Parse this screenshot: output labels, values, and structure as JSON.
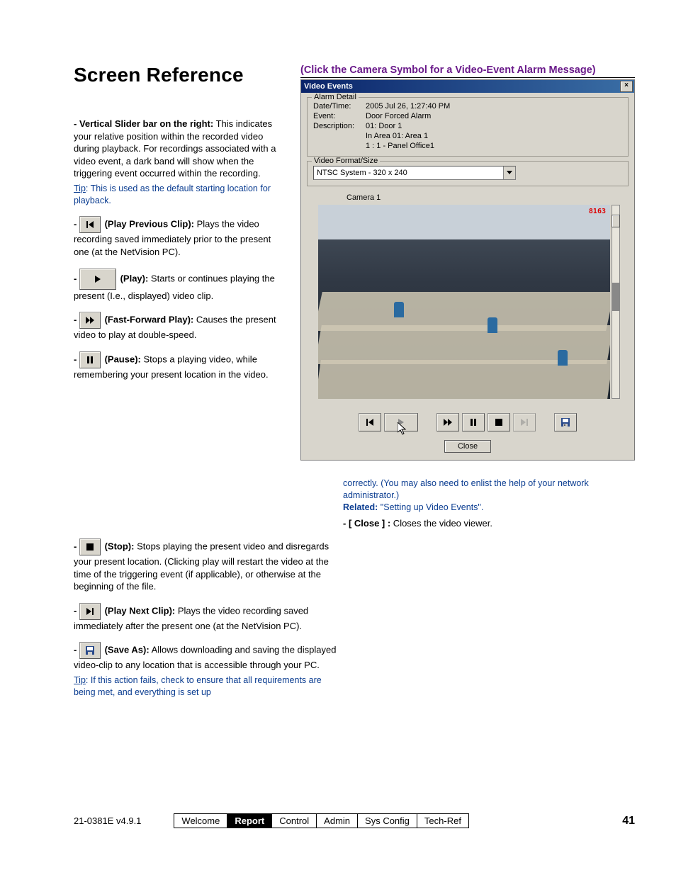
{
  "heading": "Screen Reference",
  "sub_heading": "(Click the Camera Symbol for a Video-Event Alarm Message)",
  "left": {
    "slider_label": "Vertical Slider bar on the right:",
    "slider_text": "  This indicates your relative position within the recorded video during playback.  For recordings associated with a video event, a dark band will show when the triggering event occurred within the recording.",
    "slider_tip_label": "Tip",
    "slider_tip": ":  This is used as the default starting location for playback.",
    "prev_label": " (Play Previous Clip):",
    "prev_text": "  Plays the video recording saved immediately prior to the present one (at the NetVision PC).",
    "play_label": " (Play):",
    "play_text": "  Starts or continues playing the present (I.e., displayed) video clip.",
    "ff_label": " (Fast-Forward Play):",
    "ff_text": "  Causes the present video to play at double-speed.",
    "pause_label": " (Pause):",
    "pause_text": "  Stops a playing video, while remembering your present location in the video.",
    "stop_label": " (Stop):",
    "stop_text": "  Stops playing the present video and disregards your present location.  (Clicking play will restart the video at the time of the triggering event (if applicable), or otherwise at the beginning of the file.",
    "next_label": " (Play Next Clip):",
    "next_text": "  Plays the video recording saved immediately after the present one (at the NetVision PC).",
    "save_label": " (Save As):",
    "save_text": " Allows downloading and saving the displayed video-clip to any location that is accessible through your PC.",
    "save_tip_label": "Tip",
    "save_tip": ":  If this action fails, check to ensure that all requirements are being met, and everything is set up"
  },
  "dialog": {
    "title": "Video Events",
    "group_alarm": "Alarm Detail",
    "k_date": "Date/Time:",
    "v_date": "2005 Jul 26, 1:27:40 PM",
    "k_event": "Event:",
    "v_event": "Door Forced Alarm",
    "k_desc": "Description:",
    "v_desc1": "01: Door 1",
    "v_desc2": "In Area 01: Area 1",
    "v_desc3": "1 : 1 - Panel Office1",
    "group_fmt": "Video Format/Size",
    "dropdown": "NTSC System - 320 x 240",
    "camera_label": "Camera 1",
    "timestamp_overlay": "8163",
    "close": "Close"
  },
  "right_text": {
    "continued": "correctly.  (You may also need to enlist the help of your network administrator.)",
    "related_label": "Related:",
    "related_text": "  \"Setting up Video Events\".",
    "close_label": "[ Close ] :",
    "close_text": " Closes the video viewer."
  },
  "footer": {
    "docid": "21-0381E v4.9.1",
    "tabs": [
      "Welcome",
      "Report",
      "Control",
      "Admin",
      "Sys Config",
      "Tech-Ref"
    ],
    "active_index": 1,
    "page": "41"
  }
}
